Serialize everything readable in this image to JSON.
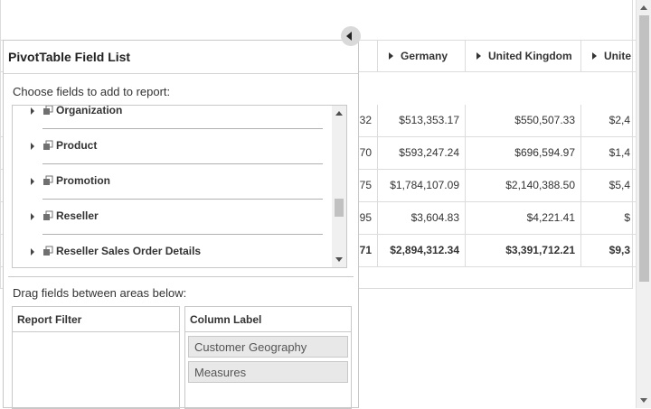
{
  "grid": {
    "column_headers": [
      "Germany",
      "United Kingdom",
      "Unite"
    ],
    "rows": [
      {
        "c0": "32",
        "c1": "$513,353.17",
        "c2": "$550,507.33",
        "c3": "$2,4"
      },
      {
        "c0": "70",
        "c1": "$593,247.24",
        "c2": "$696,594.97",
        "c3": "$1,4"
      },
      {
        "c0": "75",
        "c1": "$1,784,107.09",
        "c2": "$2,140,388.50",
        "c3": "$5,4"
      },
      {
        "c0": "95",
        "c1": "$3,604.83",
        "c2": "$4,221.41",
        "c3": "$"
      },
      {
        "c0": "71",
        "c1": "$2,894,312.34",
        "c2": "$3,391,712.21",
        "c3": "$9,3"
      }
    ]
  },
  "field_list": {
    "title": "PivotTable Field List",
    "choose_label": "Choose fields to add to report:",
    "fields": [
      "Organization",
      "Product",
      "Promotion",
      "Reseller",
      "Reseller Sales Order Details"
    ],
    "drag_label": "Drag fields between areas below:",
    "areas": {
      "report_filter": {
        "title": "Report Filter",
        "items": []
      },
      "column_label": {
        "title": "Column Label",
        "items": [
          "Customer Geography",
          "Measures"
        ]
      }
    },
    "icons": {
      "collapse": "collapse-left-icon",
      "expand": "expand-arrow-icon",
      "dimension": "dimension-icon"
    }
  },
  "colors": {
    "border": "#dcdcdc",
    "chip_bg": "#e8e8e8",
    "collapse_button": "#d9d9d9"
  }
}
